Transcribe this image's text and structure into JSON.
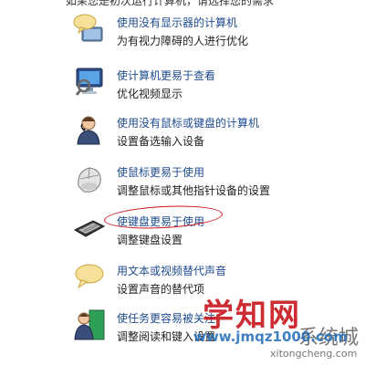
{
  "header": {
    "partial_text": "如果您是初次运行计算机，请选择您的需求"
  },
  "items": [
    {
      "title": "使用没有显示器的计算机",
      "desc": "为有视力障碍的人进行优化",
      "icon": "speech-bubble-monitor-icon"
    },
    {
      "title": "使计算机更易于查看",
      "desc": "优化视频显示",
      "icon": "monitor-magnifier-icon"
    },
    {
      "title": "使用没有鼠标或键盘的计算机",
      "desc": "设置备选输入设备",
      "icon": "person-headset-icon"
    },
    {
      "title": "使鼠标更易于使用",
      "desc": "调整鼠标或其他指针设备的设置",
      "icon": "mouse-icon"
    },
    {
      "title": "使键盘更易于使用",
      "desc": "调整键盘设置",
      "icon": "keyboard-icon"
    },
    {
      "title": "用文本或视频替代声音",
      "desc": "设置声音的替代项",
      "icon": "speech-bubble-icon"
    },
    {
      "title": "使任务更容易被关注",
      "desc": "调整阅读和键入设置",
      "icon": "person-door-icon"
    }
  ],
  "watermark": {
    "big": "学知网",
    "brand": "系统城",
    "url": "www.jmqz1000.com",
    "url2": "xitongcheng.com"
  },
  "colors": {
    "link": "#1e4b8f",
    "highlight": "#d0141c",
    "watermark_red": "#c8161d"
  }
}
